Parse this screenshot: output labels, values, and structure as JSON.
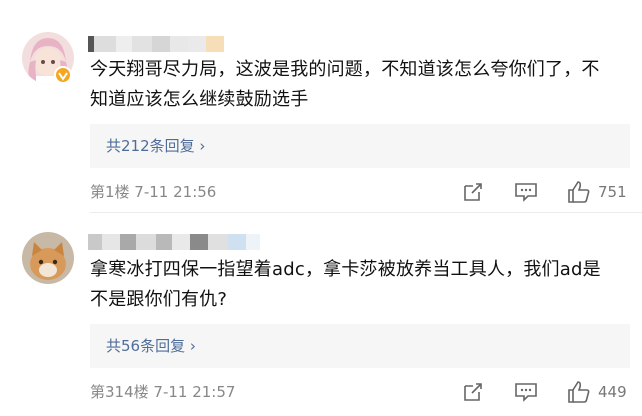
{
  "comments": [
    {
      "text_line1": "今天翔哥尽力局，这波是我的问题，不知道该怎么夸你们了，不",
      "text_line2": "知道应该怎么继续鼓励选手",
      "replies_label": "共212条回复 ›",
      "floor_time": "第1楼  7-11 21:56",
      "likes": "751",
      "verified": true
    },
    {
      "text_line1": "拿寒冰打四保一指望着adc，拿卡莎被放养当工具人，我们ad是",
      "text_line2": "不是跟你们有仇?",
      "replies_label": "共56条回复 ›",
      "floor_time": "第314楼  7-11 21:57",
      "likes": "449",
      "verified": false
    }
  ],
  "icons": {
    "edit": "share-edit-icon",
    "reply": "comment-icon",
    "like": "thumbs-up-icon"
  },
  "colors": {
    "link": "#4f6d9a",
    "meta": "#888888",
    "verified_badge": "#f5a623"
  }
}
